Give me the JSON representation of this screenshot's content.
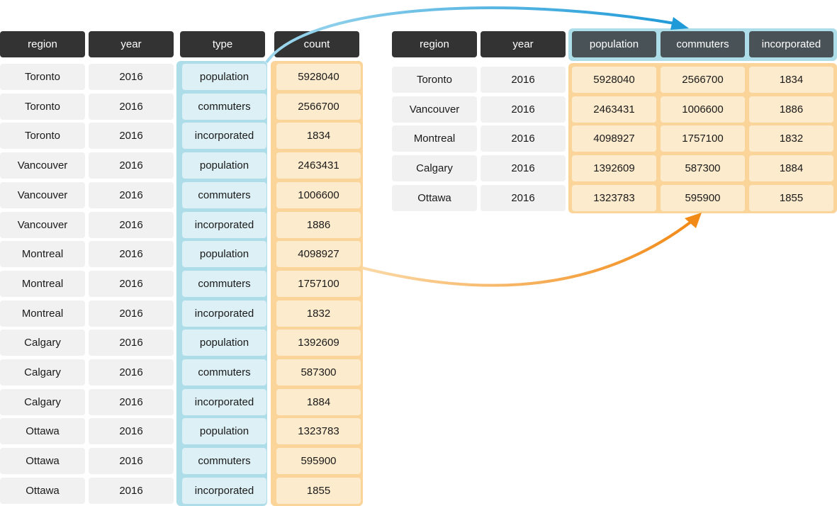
{
  "left_table": {
    "headers": [
      "region",
      "year",
      "type",
      "count"
    ],
    "rows": [
      [
        "Toronto",
        "2016",
        "population",
        "5928040"
      ],
      [
        "Toronto",
        "2016",
        "commuters",
        "2566700"
      ],
      [
        "Toronto",
        "2016",
        "incorporated",
        "1834"
      ],
      [
        "Vancouver",
        "2016",
        "population",
        "2463431"
      ],
      [
        "Vancouver",
        "2016",
        "commuters",
        "1006600"
      ],
      [
        "Vancouver",
        "2016",
        "incorporated",
        "1886"
      ],
      [
        "Montreal",
        "2016",
        "population",
        "4098927"
      ],
      [
        "Montreal",
        "2016",
        "commuters",
        "1757100"
      ],
      [
        "Montreal",
        "2016",
        "incorporated",
        "1832"
      ],
      [
        "Calgary",
        "2016",
        "population",
        "1392609"
      ],
      [
        "Calgary",
        "2016",
        "commuters",
        "587300"
      ],
      [
        "Calgary",
        "2016",
        "incorporated",
        "1884"
      ],
      [
        "Ottawa",
        "2016",
        "population",
        "1323783"
      ],
      [
        "Ottawa",
        "2016",
        "commuters",
        "595900"
      ],
      [
        "Ottawa",
        "2016",
        "incorporated",
        "1855"
      ]
    ]
  },
  "right_table": {
    "headers": [
      "region",
      "year",
      "population",
      "commuters",
      "incorporated"
    ],
    "rows": [
      [
        "Toronto",
        "2016",
        "5928040",
        "2566700",
        "1834"
      ],
      [
        "Vancouver",
        "2016",
        "2463431",
        "1006600",
        "1886"
      ],
      [
        "Montreal",
        "2016",
        "4098927",
        "1757100",
        "1832"
      ],
      [
        "Calgary",
        "2016",
        "1392609",
        "587300",
        "1884"
      ],
      [
        "Ottawa",
        "2016",
        "1323783",
        "595900",
        "1855"
      ]
    ]
  },
  "arrows": [
    {
      "from": "type column",
      "to": "new column headers",
      "color": "#2aa3dc"
    },
    {
      "from": "count column",
      "to": "new value cells",
      "color": "#f39020"
    }
  ],
  "colors": {
    "header_dark": "#333333",
    "header_pivot": "#495257",
    "cell_plain": "#f1f1f1",
    "cell_blue": "#dcf0f5",
    "frame_blue": "#addde8",
    "cell_orange": "#fdebcd",
    "frame_orange": "#fbd49a"
  }
}
